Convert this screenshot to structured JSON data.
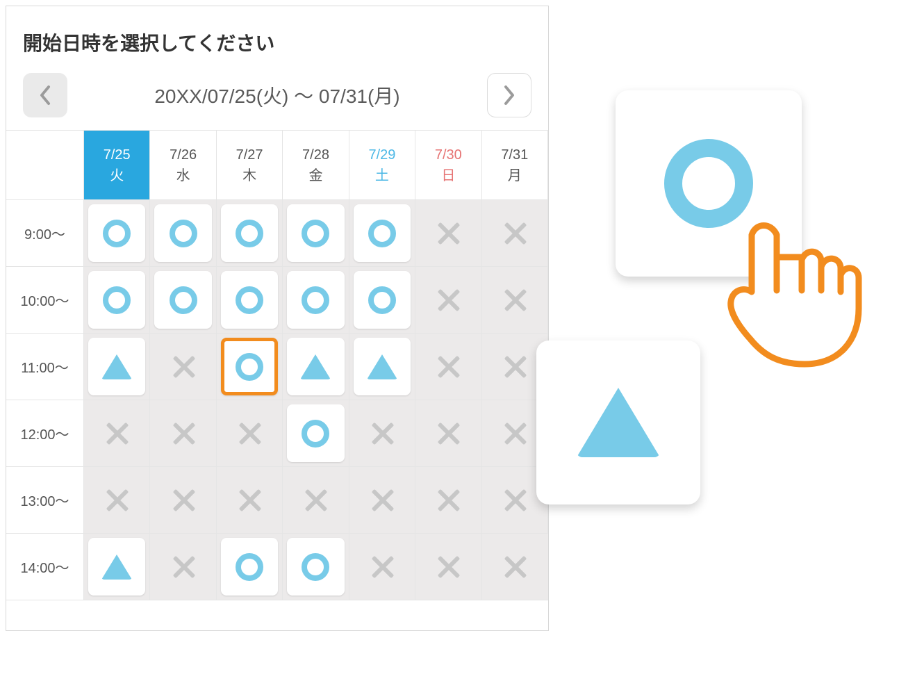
{
  "title": "開始日時を選択してください",
  "date_range": "20XX/07/25(火) ～ 07/31(月)",
  "days": [
    {
      "date": "7/25",
      "dow": "火",
      "cls": "selected"
    },
    {
      "date": "7/26",
      "dow": "水",
      "cls": ""
    },
    {
      "date": "7/27",
      "dow": "木",
      "cls": ""
    },
    {
      "date": "7/28",
      "dow": "金",
      "cls": ""
    },
    {
      "date": "7/29",
      "dow": "土",
      "cls": "sat"
    },
    {
      "date": "7/30",
      "dow": "日",
      "cls": "sun"
    },
    {
      "date": "7/31",
      "dow": "月",
      "cls": ""
    }
  ],
  "times": [
    "9:00～",
    "10:00～",
    "11:00～",
    "12:00～",
    "13:00～",
    "14:00～"
  ],
  "slots": [
    [
      "O",
      "O",
      "O",
      "O",
      "O",
      "X",
      "X"
    ],
    [
      "O",
      "O",
      "O",
      "O",
      "O",
      "X",
      "X"
    ],
    [
      "T",
      "X",
      "O*",
      "T",
      "T",
      "X",
      "X"
    ],
    [
      "X",
      "X",
      "X",
      "O",
      "X",
      "X",
      "X"
    ],
    [
      "X",
      "X",
      "X",
      "X",
      "X",
      "X",
      "X"
    ],
    [
      "T",
      "X",
      "O",
      "O",
      "X",
      "X",
      "X"
    ]
  ],
  "callouts": {
    "circle": "available",
    "triangle": "few"
  }
}
